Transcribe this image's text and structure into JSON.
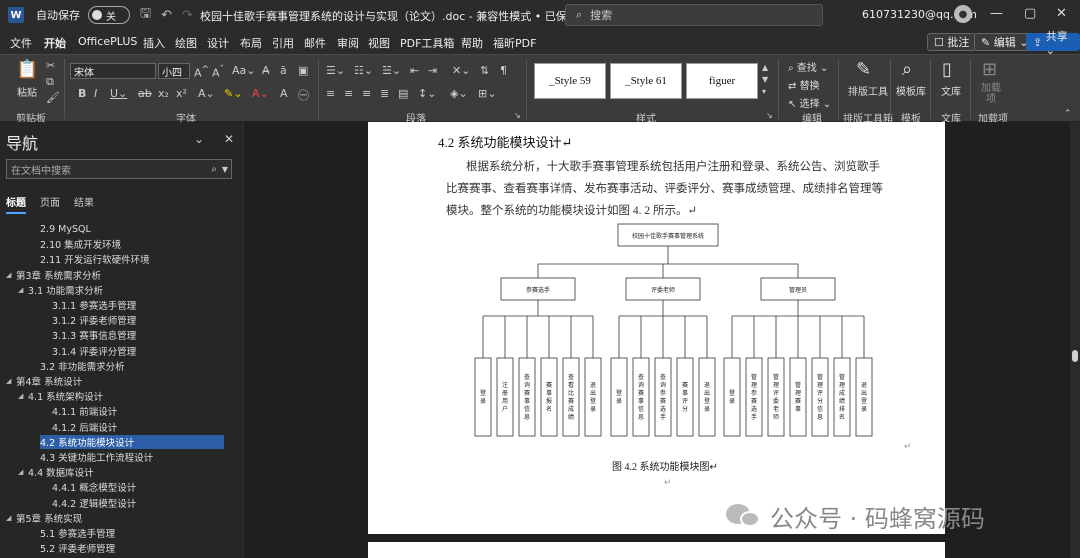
{
  "titlebar": {
    "app_icon": "W",
    "autosave_label": "自动保存",
    "autosave_state": "关",
    "doc_title": "校园十佳歌手赛事管理系统的设计与实现（论文）.doc  -  兼容性模式 • 已保存 ⌄",
    "search_placeholder": "搜索",
    "account": "610731230@qq.com",
    "min": "—",
    "max": "▢",
    "close": "✕"
  },
  "tabs": [
    "文件",
    "开始",
    "OfficePLUS",
    "插入",
    "绘图",
    "设计",
    "布局",
    "引用",
    "邮件",
    "审阅",
    "视图",
    "PDF工具箱",
    "帮助",
    "福昕PDF"
  ],
  "ribbon_buttons": {
    "comment": "批注",
    "edit": "编辑 ⌄",
    "share": "共享 ⌄"
  },
  "ribbon": {
    "paste": "粘贴",
    "clipboard": "剪贴板",
    "font_name": "宋体",
    "font_size": "小四",
    "font_group": "字体",
    "paragraph_group": "段落",
    "styles": [
      "_Style 59",
      "_Style 61",
      "figuer"
    ],
    "styles_group": "样式",
    "find": "查找",
    "replace": "替换",
    "select": "选择",
    "editing_group": "编辑",
    "layout_tool": "排版工具",
    "layout_tool_group": "排版工具箱",
    "template_lib": "模板库",
    "template_group": "模板",
    "wenku": "文库",
    "wenku_group": "文库",
    "addin": "加载项",
    "addin_group": "加载项"
  },
  "nav": {
    "title": "导航",
    "search_placeholder": "在文档中搜索",
    "tabs": [
      "标题",
      "页面",
      "结果"
    ],
    "items": [
      {
        "text": "2.9 MySQL",
        "level": 2,
        "tri": ""
      },
      {
        "text": "2.10 集成开发环境",
        "level": 2,
        "tri": ""
      },
      {
        "text": "2.11 开发运行软硬件环境",
        "level": 2,
        "tri": ""
      },
      {
        "text": "第3章 系统需求分析",
        "level": 0,
        "tri": "◢"
      },
      {
        "text": "3.1 功能需求分析",
        "level": 1,
        "tri": "◢"
      },
      {
        "text": "3.1.1 参赛选手管理",
        "level": 3,
        "tri": ""
      },
      {
        "text": "3.1.2 评委老师管理",
        "level": 3,
        "tri": ""
      },
      {
        "text": "3.1.3 赛事信息管理",
        "level": 3,
        "tri": ""
      },
      {
        "text": "3.1.4 评委评分管理",
        "level": 3,
        "tri": ""
      },
      {
        "text": "3.2 非功能需求分析",
        "level": 2,
        "tri": ""
      },
      {
        "text": "第4章 系统设计",
        "level": 0,
        "tri": "◢"
      },
      {
        "text": "4.1 系统架构设计",
        "level": 1,
        "tri": "◢"
      },
      {
        "text": "4.1.1 前端设计",
        "level": 3,
        "tri": ""
      },
      {
        "text": "4.1.2 后端设计",
        "level": 3,
        "tri": ""
      },
      {
        "text": "4.2 系统功能模块设计",
        "level": 2,
        "tri": "",
        "selected": true
      },
      {
        "text": "4.3 关键功能工作流程设计",
        "level": 2,
        "tri": ""
      },
      {
        "text": "4.4 数据库设计",
        "level": 1,
        "tri": "◢"
      },
      {
        "text": "4.4.1 概念模型设计",
        "level": 3,
        "tri": ""
      },
      {
        "text": "4.4.2 逻辑模型设计",
        "level": 3,
        "tri": ""
      },
      {
        "text": "第5章 系统实现",
        "level": 0,
        "tri": "◢"
      },
      {
        "text": "5.1 参赛选手管理",
        "level": 2,
        "tri": ""
      },
      {
        "text": "5.2 评委老师管理",
        "level": 2,
        "tri": ""
      }
    ]
  },
  "document": {
    "heading": "4.2   系统功能模块设计↵",
    "paragraph": "根据系统分析，十大歌手赛事管理系统包括用户注册和登录、系统公告、浏览歌手比赛赛事、查看赛事详情、发布赛事活动、评委评分、赛事成绩管理、成绩排名管理等模块。整个系统的功能模块设计如图 4. 2 所示。↵",
    "caption": "图 4.2  系统功能模块图↵",
    "diagram": {
      "root": "校园十佳歌手赛事管理系统",
      "roles": [
        {
          "name": "参赛选手",
          "leaves": [
            "登录",
            "注册用户",
            "查询赛事信息",
            "赛事报名",
            "查看比赛成绩",
            "退出登录"
          ]
        },
        {
          "name": "评委老师",
          "leaves": [
            "登录",
            "查询赛事信息",
            "查询参赛选手",
            "赛事评分",
            "退出登录"
          ]
        },
        {
          "name": "管理员",
          "leaves": [
            "登录",
            "管理参赛选手",
            "管理评委老师",
            "管理赛事",
            "管理评分信息",
            "管理成绩排名",
            "退出登录"
          ]
        }
      ]
    }
  },
  "watermark": "公众号 · 码蜂窝源码"
}
